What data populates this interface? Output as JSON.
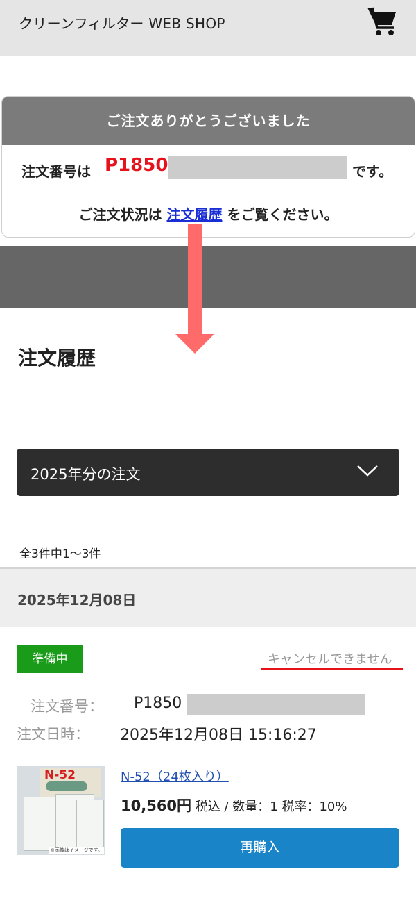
{
  "header": {
    "title": "クリーンフィルター WEB SHOP",
    "cart_icon": "shopping-cart-icon"
  },
  "thanks": {
    "heading": "ご注文ありがとうございました",
    "order_prefix": "注文番号は",
    "order_number": "P1850",
    "order_suffix": "です。",
    "status_prefix": "ご注文状況は",
    "status_link": "注文履歴",
    "status_suffix": "をご覧ください。"
  },
  "colors": {
    "accent_red": "#e5121c",
    "arrow": "#ff6a6a",
    "status_green": "#1a9c1a",
    "button_blue": "#1a84c9",
    "link_blue": "#1a2fd6"
  },
  "history": {
    "title": "注文履歴",
    "year_select": "2025年分の注文",
    "count": "全3件中1〜3件"
  },
  "order": {
    "date": "2025年12月08日",
    "status": "準備中",
    "cancel_note": "キャンセルできません",
    "number_label": "注文番号：",
    "number_value": "P1850",
    "datetime_label": "注文日時：",
    "datetime_value": "2025年12月08日 15:16:27",
    "item": {
      "name": "N-52（24枚入り）",
      "price": "10,560円",
      "details": "税込 / 数量：1 税率：10%",
      "thumb_code": "N-52",
      "thumb_note": "※画像はイメージです。"
    },
    "rebuy_label": "再購入"
  }
}
